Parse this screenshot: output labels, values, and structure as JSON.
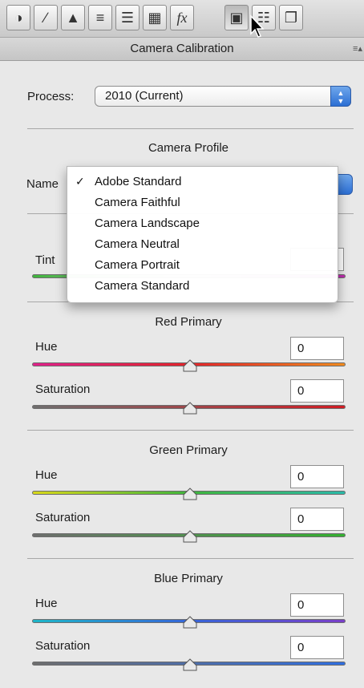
{
  "toolbar": {
    "tools": [
      {
        "name": "basic-tab-icon",
        "glyph": "◑"
      },
      {
        "name": "tone-curve-tab-icon",
        "glyph": "∕"
      },
      {
        "name": "detail-tab-icon",
        "glyph": "▲"
      },
      {
        "name": "hsl-tab-icon",
        "glyph": "≡"
      },
      {
        "name": "split-toning-tab-icon",
        "glyph": "☰"
      },
      {
        "name": "lens-corrections-tab-icon",
        "glyph": "▦"
      },
      {
        "name": "effects-tab-icon",
        "glyph": "fx"
      },
      {
        "name": "camera-calibration-tab-icon",
        "glyph": "▣"
      },
      {
        "name": "presets-tab-icon",
        "glyph": "☷"
      },
      {
        "name": "snapshots-tab-icon",
        "glyph": "❐"
      }
    ],
    "active_index": 7
  },
  "header": {
    "title": "Camera Calibration",
    "menu_glyph": "≡▴"
  },
  "process": {
    "label": "Process:",
    "value": "2010 (Current)"
  },
  "camera_profile": {
    "heading": "Camera Profile",
    "name_label": "Name",
    "options": [
      "Adobe Standard",
      "Camera Faithful",
      "Camera Landscape",
      "Camera Neutral",
      "Camera Portrait",
      "Camera Standard"
    ],
    "selected_index": 0,
    "check_glyph": "✓"
  },
  "shadows": {
    "tint_label": "Tint"
  },
  "red_primary": {
    "heading": "Red Primary",
    "hue_label": "Hue",
    "hue_value": "0",
    "saturation_label": "Saturation",
    "saturation_value": "0"
  },
  "green_primary": {
    "heading": "Green Primary",
    "hue_label": "Hue",
    "hue_value": "0",
    "saturation_label": "Saturation",
    "saturation_value": "0"
  },
  "blue_primary": {
    "heading": "Blue Primary",
    "hue_label": "Hue",
    "hue_value": "0",
    "saturation_label": "Saturation",
    "saturation_value": "0"
  },
  "colors": {
    "accent_blue": "#2c6fd4",
    "red_hue_track": "linear-gradient(90deg,#e0208a,#e2232a,#f08a1e)",
    "red_sat_track": "linear-gradient(90deg,#6e6e6e,#d01c24)",
    "green_hue_track": "linear-gradient(90deg,#d8d81a,#3fb53c,#2ab9a8)",
    "green_sat_track": "linear-gradient(90deg,#6e6e6e,#34b030)",
    "blue_hue_track": "linear-gradient(90deg,#1eb6c8,#3565d8,#7a3fc8)",
    "blue_sat_track": "linear-gradient(90deg,#6e6e6e,#2f6ee0)",
    "tint_track": "linear-gradient(90deg,#3fb53c,#c0c0c0,#c02ab0)"
  }
}
